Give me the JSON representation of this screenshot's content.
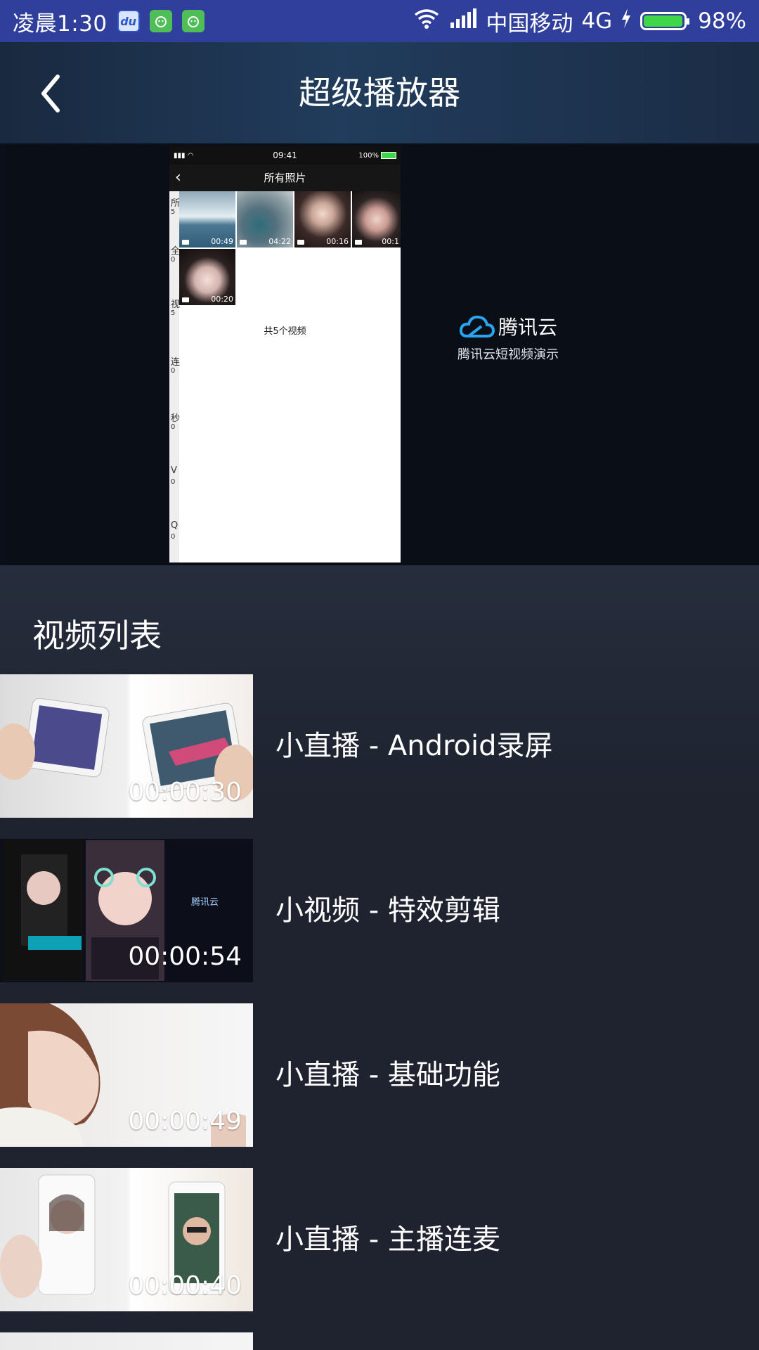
{
  "status_bar": {
    "time": "凌晨1:30",
    "apps": [
      "du",
      "cat",
      "cat"
    ],
    "carrier": "中国移动",
    "network": "4G",
    "battery_level": 0.98,
    "battery_label": "98%"
  },
  "header": {
    "title": "超级播放器",
    "back_icon": "chevron-left-icon"
  },
  "player": {
    "phone_status": {
      "time": "09:41",
      "battery": "100%"
    },
    "phone_nav_title": "所有照片",
    "thumb_durations": [
      "00:49",
      "04:22",
      "00:16",
      "00:1",
      "00:20"
    ],
    "side_labels": [
      "所",
      "5",
      "全",
      "0",
      "视",
      "5",
      "连",
      "0",
      "秒",
      "0",
      "V",
      "0",
      "Q",
      "0"
    ],
    "count_text": "共5个视频",
    "logo_name": "腾讯云",
    "logo_subtitle": "腾讯云短视频演示"
  },
  "list": {
    "section_title": "视频列表",
    "items": [
      {
        "title": "小直播 - Android录屏",
        "duration": "00:00:30"
      },
      {
        "title": "小视频 - 特效剪辑",
        "duration": "00:00:54"
      },
      {
        "title": "小直播 - 基础功能",
        "duration": "00:00:49"
      },
      {
        "title": "小直播 - 主播连麦",
        "duration": "00:00:40"
      }
    ]
  },
  "colors": {
    "status_bar": "#2f3f9b",
    "header_bg": "#1d3350",
    "list_bg": "#1f2330",
    "logo_blue": "#2aa3f0"
  }
}
